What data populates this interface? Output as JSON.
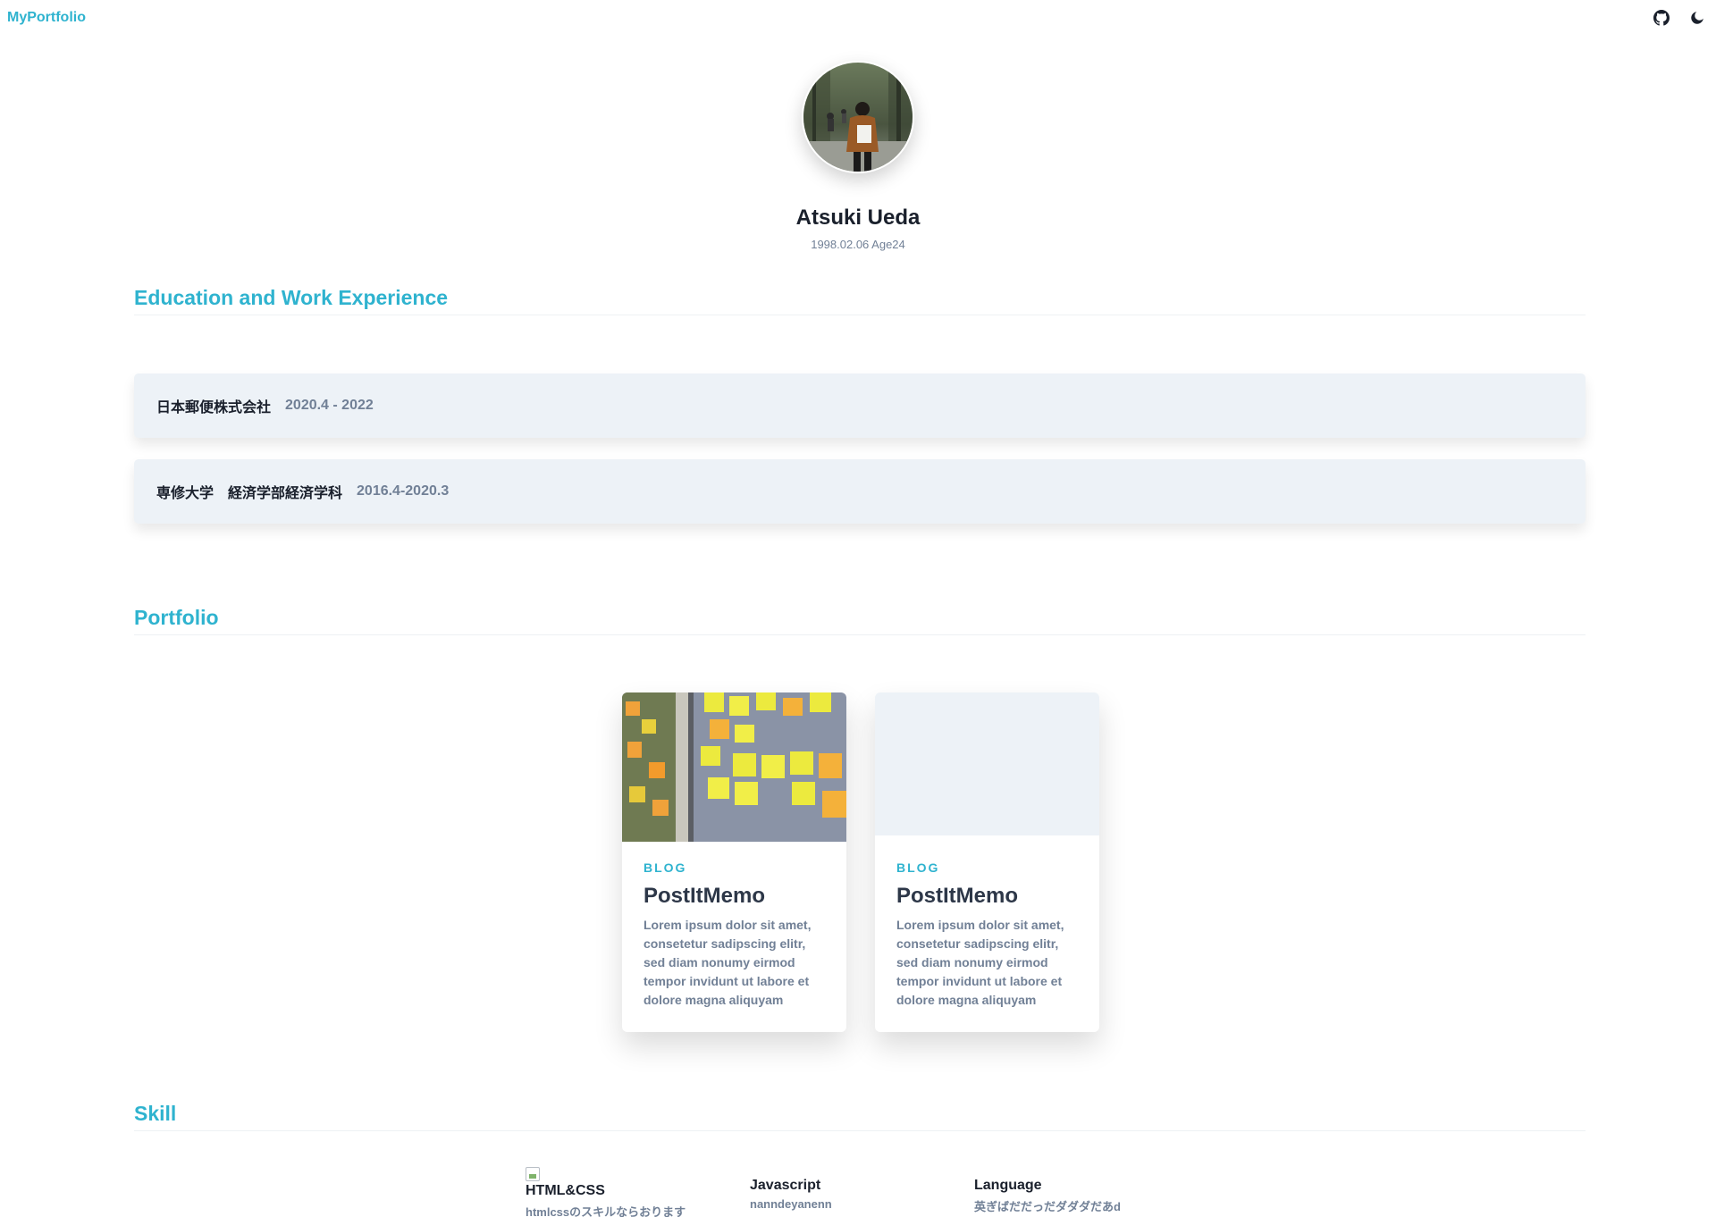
{
  "nav": {
    "brand": "MyPortfolio",
    "icons": [
      "github-icon",
      "moon-icon"
    ]
  },
  "profile": {
    "name": "Atsuki Ueda",
    "dob": "1998.02.06 Age24"
  },
  "experience": {
    "heading": "Education and Work Experience",
    "items": [
      {
        "name": "日本郵便株式会社",
        "period": "2020.4 - 2022"
      },
      {
        "name": "専修大学　経済学部経済学科",
        "period": "2016.4-2020.3"
      }
    ]
  },
  "portfolio": {
    "heading": "Portfolio",
    "cards": [
      {
        "category": "BLOG",
        "title": "PostItMemo",
        "description": "Lorem ipsum dolor sit amet, consetetur sadipscing elitr, sed diam nonumy eirmod tempor invidunt ut labore et dolore magna aliquyam"
      },
      {
        "category": "BLOG",
        "title": "PostItMemo",
        "description": "Lorem ipsum dolor sit amet, consetetur sadipscing elitr, sed diam nonumy eirmod tempor invidunt ut labore et dolore magna aliquyam"
      }
    ]
  },
  "skills": {
    "heading": "Skill",
    "items": [
      {
        "title": "HTML&CSS",
        "description": "htmlcssのスキルならおります"
      },
      {
        "title": "Javascript",
        "description": "nanndeyanenn"
      },
      {
        "title": "Language",
        "description": "英ぎばだだっだダダダだあd"
      }
    ]
  },
  "colors": {
    "accent": "#2fb3cf",
    "card_bg": "#edf2f7",
    "muted_text": "#718096"
  }
}
